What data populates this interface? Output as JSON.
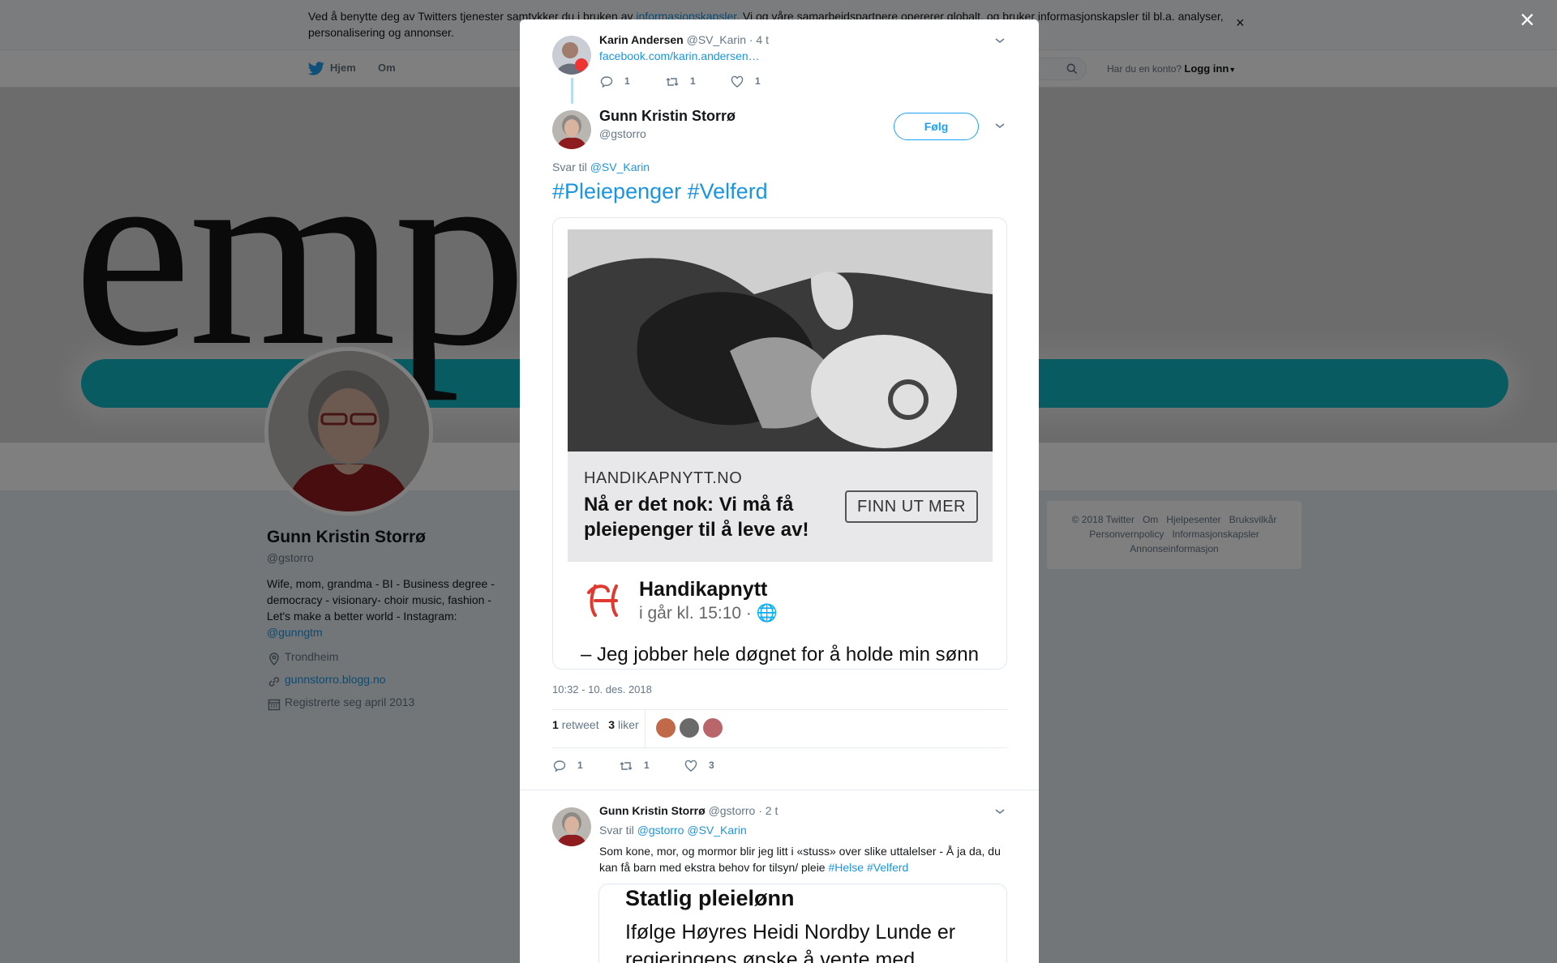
{
  "cookie_bar": {
    "text_before": "Ved å benytte deg av Twitters tjenester samtykker du i bruken av ",
    "link": "informasjonskapsler",
    "text_after": ". Vi og våre samarbeidspartnere opererer globalt, og bruker informasjonskapsler til bl.a. analyser, personalisering og annonser.",
    "close": "×"
  },
  "nav": {
    "home": "Hjem",
    "about": "Om",
    "account_prompt": "Har du en konto?",
    "login": "Logg inn"
  },
  "banner": {
    "text": "empathy"
  },
  "profile": {
    "name": "Gunn Kristin Storrø",
    "handle": "@gstorro",
    "bio": "Wife, mom, grandma - BI - Business degree - democracy - visionary- choir music, fashion - Let's make a better world - Instagram:",
    "bio_link": "@gunngtm",
    "location": "Trondheim",
    "website": "gunnstorro.blogg.no",
    "joined": "Registrerte seg april 2013"
  },
  "footer": {
    "links": [
      "© 2018 Twitter",
      "Om",
      "Hjelpesenter",
      "Bruksvilkår",
      "Personvernpolicy",
      "Informasjonskapsler",
      "Annonseinformasjon"
    ]
  },
  "overlay": {
    "close": "×"
  },
  "parent_tweet": {
    "name": "Karin Andersen",
    "handle": "@SV_Karin",
    "time": "· 4 t",
    "link": "facebook.com/karin.andersen…",
    "replies": "1",
    "retweets": "1",
    "likes": "1"
  },
  "main_tweet": {
    "name": "Gunn Kristin Storrø",
    "handle": "@gstorro",
    "follow": "Følg",
    "reply_to_label": "Svar til",
    "reply_to": "@SV_Karin",
    "hashtags": "#Pleiepenger #Velferd",
    "card": {
      "site": "HANDIKAPNYTT.NO",
      "title": "Nå er det nok: Vi må få pleiepenger til å leve av!",
      "button": "FINN UT MER",
      "source_name": "Handikapnytt",
      "source_time": "i går kl. 15:10 ·",
      "quote": "– Jeg jobber hele døgnet for å holde min sønn i live. Fordi vi bor der vi bor, må jeg ordne"
    },
    "timestamp": "10:32 - 10. des. 2018",
    "retweet_count": "1",
    "retweet_label": "retweet",
    "like_count": "3",
    "like_label": "liker",
    "replies": "1",
    "retweets": "1",
    "likes": "3"
  },
  "reply_tweet": {
    "name": "Gunn Kristin Storrø",
    "handle": "@gstorro",
    "time": "· 2 t",
    "reply_to_label": "Svar til",
    "reply_to_1": "@gstorro",
    "reply_to_2": "@SV_Karin",
    "text": "Som kone, mor, og mormor blir jeg litt i «stuss» over slike uttalelser - Å ja da, du kan få barn med ekstra behov for tilsyn/ pleie",
    "tag1": "#Helse",
    "tag2": "#Velferd",
    "image_title": "Statlig pleielønn",
    "image_text": "Ifølge Høyres Heidi Nordby Lunde er regjeringens ønske å vente med"
  },
  "colors": {
    "link": "#1b95e0",
    "twitter_blue": "#1da1f2",
    "banner_stripe": "#12b7c4"
  }
}
